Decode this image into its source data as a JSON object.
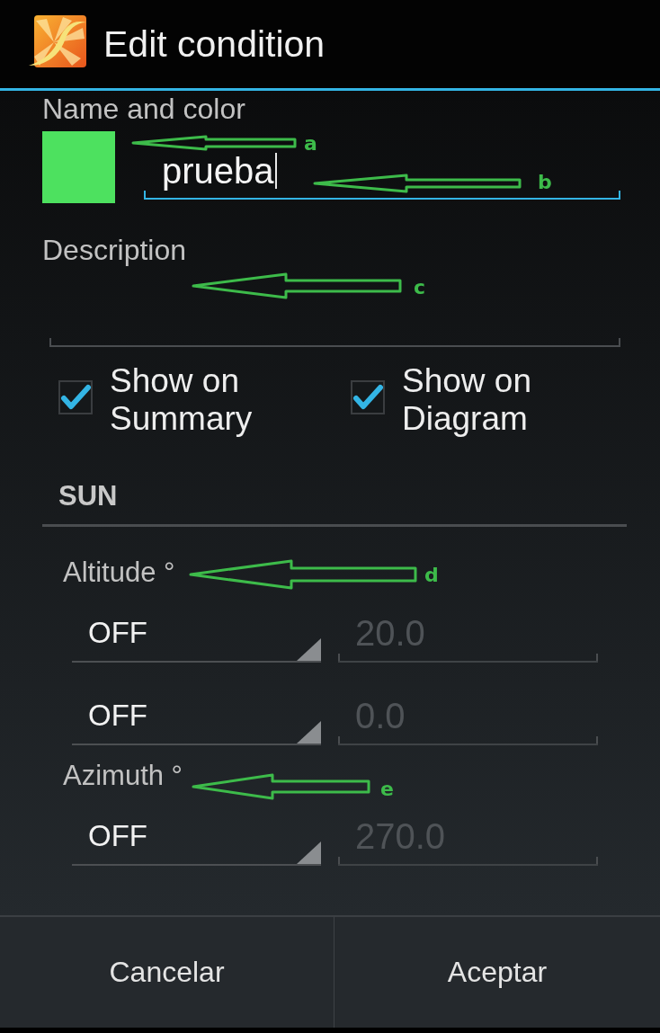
{
  "window": {
    "title": "Edit condition"
  },
  "name_section": {
    "label": "Name and color",
    "color": "#4de15f",
    "field": {
      "value": "prueba",
      "focused": true
    }
  },
  "description_section": {
    "label": "Description"
  },
  "options": [
    {
      "label": "Show on Summary",
      "checked": true
    },
    {
      "label": "Show on Diagram",
      "checked": true
    }
  ],
  "sun_section": {
    "title": "SUN",
    "groups": [
      {
        "label": "Altitude °",
        "rows": [
          {
            "mode": "OFF",
            "value": "20.0",
            "disabled": true
          },
          {
            "mode": "OFF",
            "value": "0.0",
            "disabled": true
          }
        ]
      },
      {
        "label": "Azimuth °",
        "rows": [
          {
            "mode": "OFF",
            "value": "270.0",
            "disabled": true
          }
        ]
      }
    ]
  },
  "buttons": [
    {
      "label": "Cancelar"
    },
    {
      "label": "Aceptar"
    }
  ],
  "annotations": [
    {
      "label": "a"
    },
    {
      "label": "b"
    },
    {
      "label": "c"
    },
    {
      "label": "d"
    },
    {
      "label": "e"
    }
  ]
}
